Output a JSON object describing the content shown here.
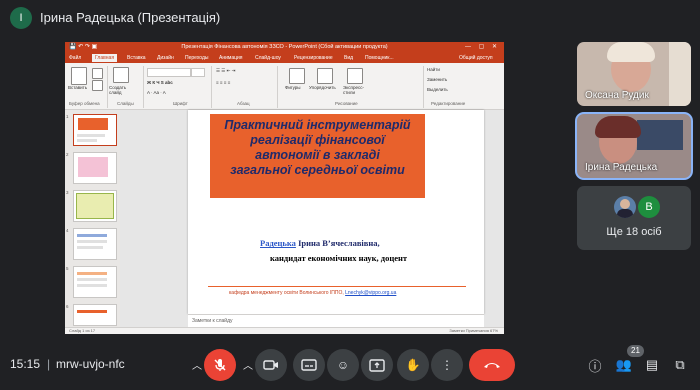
{
  "topbar": {
    "presenter_initial": "І",
    "title": "Ірина Радецька (Презентація)"
  },
  "powerpoint": {
    "window_title": "Презентація Фінансова автономія ЗЗСО - PowerPoint (Сбой активации продукта)",
    "tabs": [
      "Файл",
      "Главная",
      "Вставка",
      "Дизайн",
      "Переходы",
      "Анимация",
      "Слайд-шоу",
      "Рецензирование",
      "Вид"
    ],
    "search_hint": "Помощник...",
    "share_button": "Общий доступ",
    "ribbon": {
      "paste": "Вставить",
      "create_slide": "Создать слайд",
      "groups": [
        "Буфер обмена",
        "Слайды",
        "Шрифт",
        "Абзац",
        "Рисование",
        "Редактирование"
      ],
      "shapes": "Фигуры",
      "arrange": "Упорядочить",
      "express_styles": "Экспресс-стили",
      "find": "Найти",
      "replace": "Заменить",
      "select": "Выделить"
    },
    "thumbnail_numbers": [
      "1",
      "2",
      "3",
      "4",
      "5",
      "6"
    ],
    "slide": {
      "title_lines": [
        "Практичний інструментарій",
        "реалізації фінансової",
        "автономії в закладі",
        "загальної середньої освіти"
      ],
      "author_underlined": "Радецька",
      "author_rest": " Ірина В’ячеславівна,",
      "degree": "кандидат економічних наук, доцент",
      "footer_text": "кафедра менеджменту освіти Волинського ІППО, ",
      "footer_email": "Lnechyk@vippo.org.ua"
    },
    "notes_placeholder": "Заметки к слайду",
    "status_left": "Слайд 1 из 17",
    "status_right": "Заметки   Примечания   67%"
  },
  "participants": [
    {
      "name": "Оксана Рудик"
    },
    {
      "name": "Ірина Радецька"
    }
  ],
  "more": {
    "avatar_letter": "B",
    "label": "Ще 18 осіб"
  },
  "bottombar": {
    "time": "15:15",
    "separator": "|",
    "meeting_code": "mrw-uvjo-nfc",
    "participants_count": "21"
  },
  "colors": {
    "brand_powerpoint": "#c43e1c",
    "slide_title_bg": "#e8612c",
    "mic_off": "#ea4335",
    "end_call": "#ea4335",
    "active_speaker": "#8ab4f8"
  },
  "icons": [
    "mic-off-icon",
    "camera-icon",
    "captions-icon",
    "emoji-icon",
    "present-icon",
    "raise-hand-icon",
    "more-options-icon",
    "end-call-icon",
    "info-icon",
    "people-icon",
    "chat-icon",
    "activities-icon"
  ]
}
